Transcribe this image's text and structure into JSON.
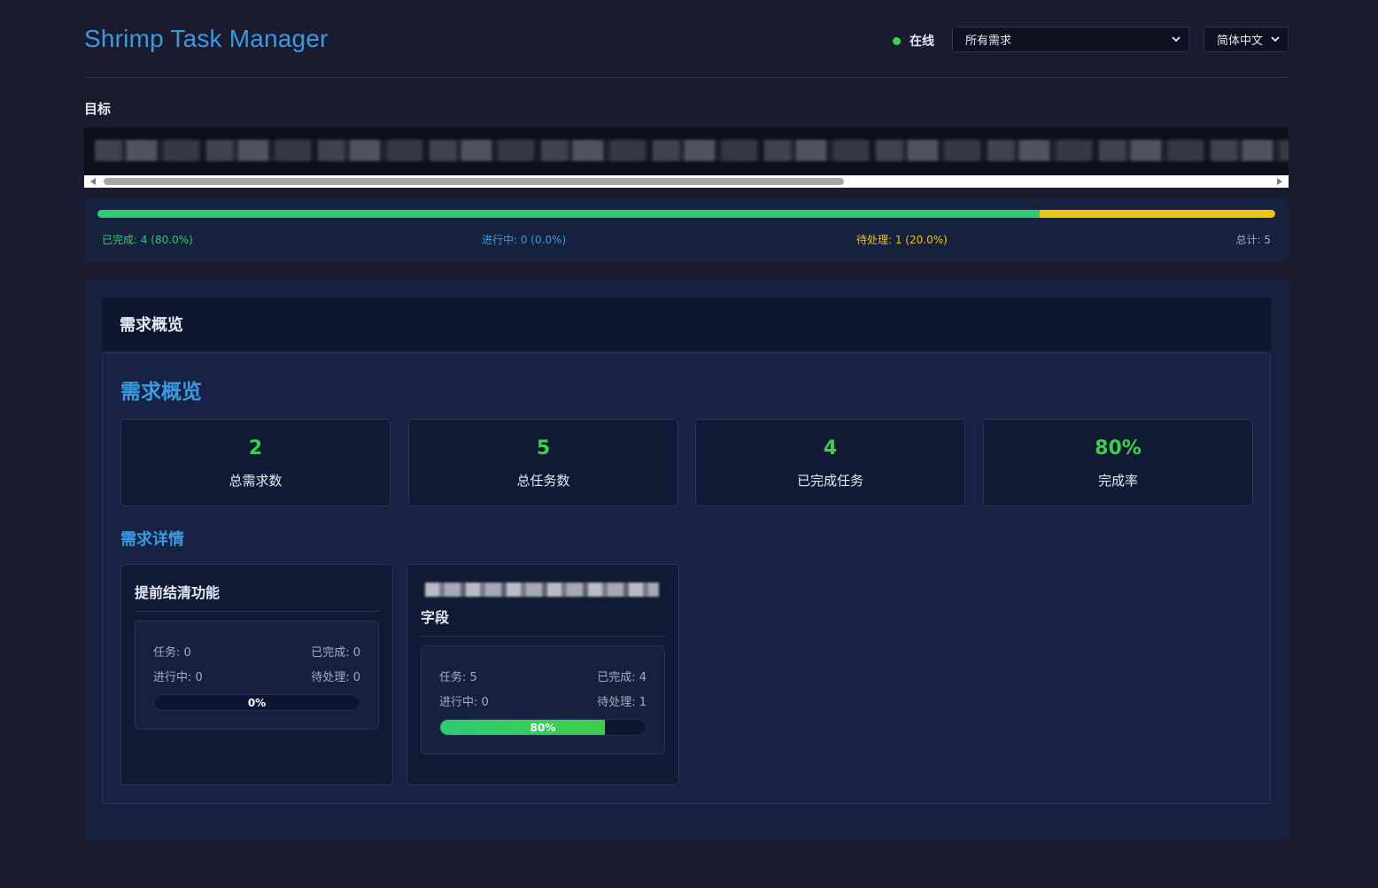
{
  "header": {
    "title": "Shrimp Task Manager",
    "status": "在线",
    "status_color": "#3ecf4a",
    "requirement_select": "所有需求",
    "language_select": "简体中文"
  },
  "goal": {
    "label": "目标"
  },
  "progress": {
    "done_fraction": 0.8,
    "in_progress_fraction": 0.0,
    "pending_fraction": 0.2,
    "done_label": "已完成: 4 (80.0%)",
    "in_progress_label": "进行中: 0 (0.0%)",
    "pending_label": "待处理: 1 (20.0%)",
    "total_label": "总计: 5",
    "colors": {
      "done": "#2ecc71",
      "in_progress": "#3498db",
      "pending": "#f1c40f"
    }
  },
  "overview": {
    "section_title": "需求概览",
    "heading": "需求概览",
    "stats": [
      {
        "value": "2",
        "label": "总需求数"
      },
      {
        "value": "5",
        "label": "总任务数"
      },
      {
        "value": "4",
        "label": "已完成任务"
      },
      {
        "value": "80%",
        "label": "完成率"
      }
    ],
    "details_heading": "需求详情",
    "requirements": [
      {
        "title": "提前结清功能",
        "tasks": "任务: 0",
        "completed": "已完成: 0",
        "in_progress": "进行中: 0",
        "pending": "待处理: 0",
        "percent_label": "0%",
        "percent": 0
      },
      {
        "title": "字段",
        "tasks": "任务: 5",
        "completed": "已完成: 4",
        "in_progress": "进行中: 0",
        "pending": "待处理: 1",
        "percent_label": "80%",
        "percent": 80
      }
    ]
  }
}
